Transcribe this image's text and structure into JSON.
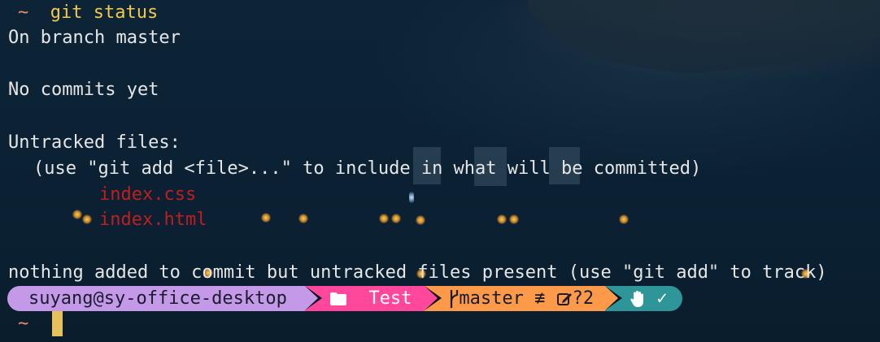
{
  "terminal": {
    "prompt_symbol": "~",
    "command": "git status",
    "output": {
      "branch_line": "On branch master",
      "commits_line": "No commits yet",
      "untracked_header": "Untracked files:",
      "hint_line": "(use \"git add <file>...\" to include in what will be committed)",
      "untracked_files": [
        "index.css",
        "index.html"
      ],
      "summary_line": "nothing added to commit but untracked files present (use \"git add\" to track)"
    },
    "powerline": {
      "user_host": "suyang@sy-office-desktop",
      "directory": "Test",
      "branch": "master",
      "branch_status": "≢",
      "untracked_count": "?2",
      "status_ok": "✓"
    },
    "next_prompt_symbol": "~"
  },
  "colors": {
    "prompt_tilde": "#f08a6c",
    "command": "#f2c94c",
    "untracked": "#c01d1d",
    "seg_user": "#c49ae8",
    "seg_dir": "#ff479c",
    "seg_git": "#fc9a4a",
    "seg_status": "#2e9599",
    "cursor": "#e7c25a"
  }
}
